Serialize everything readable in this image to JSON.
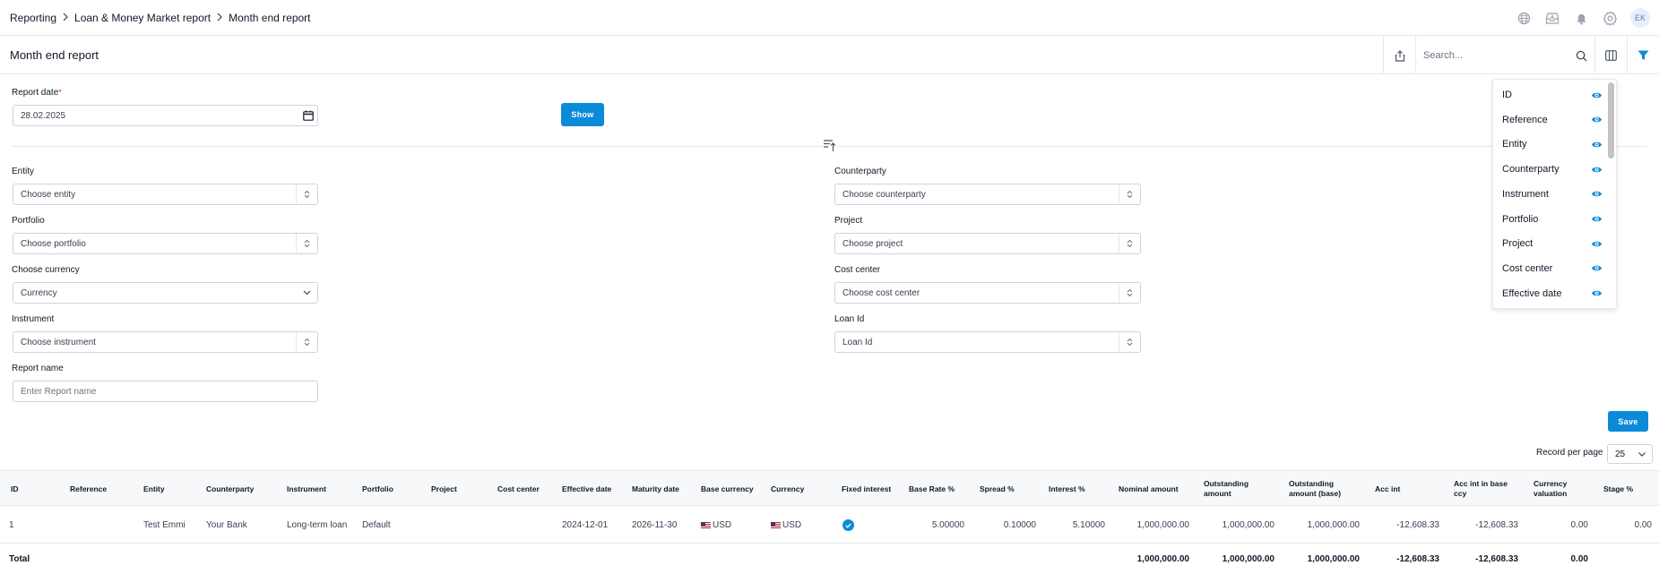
{
  "breadcrumb": [
    "Reporting",
    "Loan & Money Market report",
    "Month end report"
  ],
  "topbar": {
    "avatar_initials": "EK",
    "icons": [
      "globe-icon",
      "inbox-icon",
      "bell-icon",
      "gear-icon"
    ]
  },
  "page": {
    "title": "Month end report"
  },
  "search": {
    "placeholder": "Search..."
  },
  "form": {
    "report_date": {
      "label": "Report date",
      "required_mark": "*",
      "value": "28.02.2025"
    },
    "show_label": "Show",
    "entity": {
      "label": "Entity",
      "placeholder": "Choose entity"
    },
    "counterparty": {
      "label": "Counterparty",
      "placeholder": "Choose counterparty"
    },
    "portfolio": {
      "label": "Portfolio",
      "placeholder": "Choose portfolio"
    },
    "project": {
      "label": "Project",
      "placeholder": "Choose project"
    },
    "currency": {
      "label": "Choose currency",
      "placeholder": "Currency"
    },
    "cost_center": {
      "label": "Cost center",
      "placeholder": "Choose cost center"
    },
    "instrument": {
      "label": "Instrument",
      "placeholder": "Choose instrument"
    },
    "loan_id": {
      "label": "Loan Id",
      "placeholder": "Loan Id"
    },
    "report_name": {
      "label": "Report name",
      "placeholder": "Enter Report name"
    },
    "save_label": "Save"
  },
  "column_panel": {
    "items": [
      "ID",
      "Reference",
      "Entity",
      "Counterparty",
      "Instrument",
      "Portfolio",
      "Project",
      "Cost center",
      "Effective date"
    ]
  },
  "pagination": {
    "label": "Record per page",
    "value": "25"
  },
  "table": {
    "headers": {
      "id": "ID",
      "reference": "Reference",
      "entity": "Entity",
      "counterparty": "Counterparty",
      "instrument": "Instrument",
      "portfolio": "Portfolio",
      "project": "Project",
      "cost_center": "Cost center",
      "effective_date": "Effective date",
      "maturity_date": "Maturity date",
      "base_currency": "Base currency",
      "currency": "Currency",
      "fixed_interest": "Fixed interest",
      "base_rate": "Base Rate %",
      "spread": "Spread %",
      "interest": "Interest %",
      "nominal": "Nominal amount",
      "outstanding_1": "Outstanding",
      "outstanding_2": "amount",
      "outstanding_base_1": "Outstanding",
      "outstanding_base_2": "amount (base)",
      "acc_int": "Acc int",
      "acc_int_base_1": "Acc int in base",
      "acc_int_base_2": "ccy",
      "currency_val_1": "Currency",
      "currency_val_2": "valuation",
      "stage": "Stage %"
    },
    "row": {
      "id": "1",
      "reference": "",
      "entity": "Test Emmi",
      "counterparty": "Your Bank",
      "instrument": "Long-term loan",
      "portfolio": "Default",
      "project": "",
      "cost_center": "",
      "effective_date": "2024-12-01",
      "maturity_date": "2026-11-30",
      "base_currency": "USD",
      "currency": "USD",
      "base_rate": "5.00000",
      "spread": "0.10000",
      "interest": "5.10000",
      "nominal": "1,000,000.00",
      "outstanding": "1,000,000.00",
      "outstanding_base": "1,000,000.00",
      "acc_int": "-12,608.33",
      "acc_int_base": "-12,608.33",
      "currency_val": "0.00",
      "stage": "0.00"
    },
    "total": {
      "label": "Total",
      "nominal": "1,000,000.00",
      "outstanding": "1,000,000.00",
      "outstanding_base": "1,000,000.00",
      "acc_int": "-12,608.33",
      "acc_int_base": "-12,608.33",
      "currency_val": "0.00"
    }
  },
  "colors": {
    "accent": "#0b8ad9",
    "border": "#e5e7eb"
  }
}
